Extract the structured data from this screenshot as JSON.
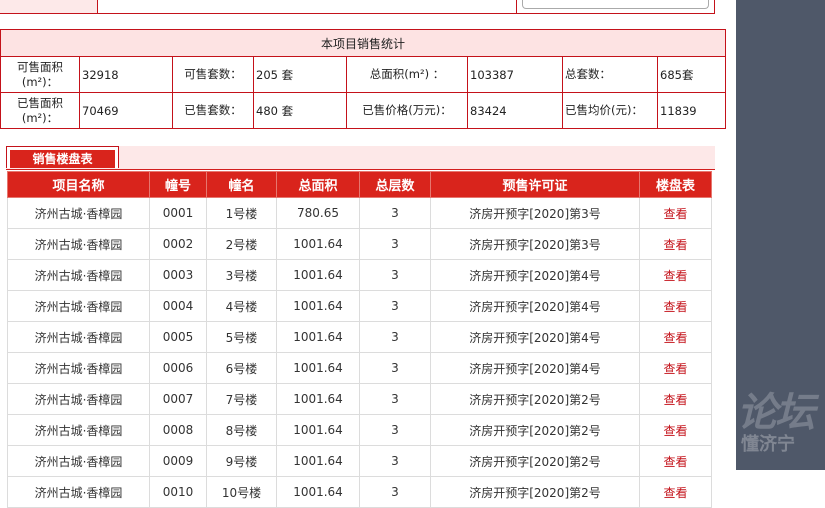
{
  "stats": {
    "header": "本项目销售统计",
    "row1": {
      "avail_area_label": "可售面积(m²)：",
      "avail_area_value": "32918",
      "avail_units_label": "可售套数：",
      "avail_units_value": "205 套",
      "total_area_label": "总面积(m²) ：",
      "total_area_value": "103387",
      "total_units_label": "总套数：",
      "total_units_value": "685套"
    },
    "row2": {
      "sold_area_label": "已售面积(m²)：",
      "sold_area_value": "70469",
      "sold_units_label": "已售套数：",
      "sold_units_value": "480 套",
      "sold_price_label": "已售价格(万元)：",
      "sold_price_value": "83424",
      "avg_price_label": "已售均价(元)：",
      "avg_price_value": "11839"
    }
  },
  "tab": {
    "label": "销售楼盘表"
  },
  "table": {
    "headers": [
      "项目名称",
      "幢号",
      "幢名",
      "总面积",
      "总层数",
      "预售许可证",
      "楼盘表"
    ],
    "rows": [
      {
        "name": "济州古城·香樟园",
        "no": "0001",
        "bname": "1号楼",
        "area": "780.65",
        "floors": "3",
        "permit": "济房开预字[2020]第3号",
        "link": "查看"
      },
      {
        "name": "济州古城·香樟园",
        "no": "0002",
        "bname": "2号楼",
        "area": "1001.64",
        "floors": "3",
        "permit": "济房开预字[2020]第3号",
        "link": "查看"
      },
      {
        "name": "济州古城·香樟园",
        "no": "0003",
        "bname": "3号楼",
        "area": "1001.64",
        "floors": "3",
        "permit": "济房开预字[2020]第4号",
        "link": "查看"
      },
      {
        "name": "济州古城·香樟园",
        "no": "0004",
        "bname": "4号楼",
        "area": "1001.64",
        "floors": "3",
        "permit": "济房开预字[2020]第4号",
        "link": "查看"
      },
      {
        "name": "济州古城·香樟园",
        "no": "0005",
        "bname": "5号楼",
        "area": "1001.64",
        "floors": "3",
        "permit": "济房开预字[2020]第4号",
        "link": "查看"
      },
      {
        "name": "济州古城·香樟园",
        "no": "0006",
        "bname": "6号楼",
        "area": "1001.64",
        "floors": "3",
        "permit": "济房开预字[2020]第4号",
        "link": "查看"
      },
      {
        "name": "济州古城·香樟园",
        "no": "0007",
        "bname": "7号楼",
        "area": "1001.64",
        "floors": "3",
        "permit": "济房开预字[2020]第2号",
        "link": "查看"
      },
      {
        "name": "济州古城·香樟园",
        "no": "0008",
        "bname": "8号楼",
        "area": "1001.64",
        "floors": "3",
        "permit": "济房开预字[2020]第2号",
        "link": "查看"
      },
      {
        "name": "济州古城·香樟园",
        "no": "0009",
        "bname": "9号楼",
        "area": "1001.64",
        "floors": "3",
        "permit": "济房开预字[2020]第2号",
        "link": "查看"
      },
      {
        "name": "济州古城·香樟园",
        "no": "0010",
        "bname": "10号楼",
        "area": "1001.64",
        "floors": "3",
        "permit": "济房开预字[2020]第2号",
        "link": "查看"
      }
    ]
  },
  "watermark": {
    "big": "论坛",
    "small": "懂济宁"
  }
}
